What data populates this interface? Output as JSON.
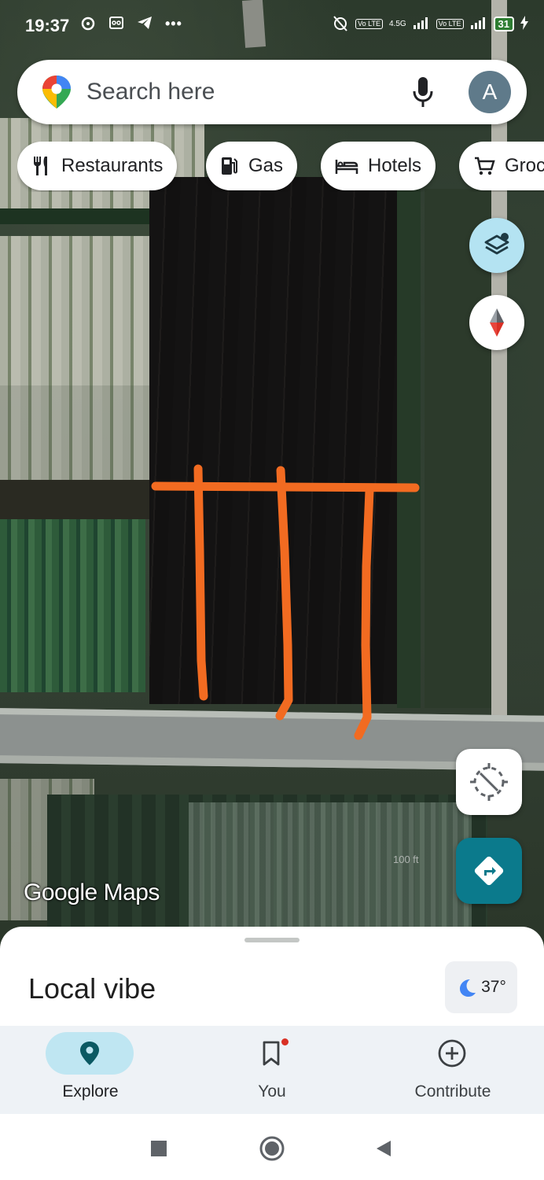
{
  "status_bar": {
    "time": "19:37",
    "battery": "31",
    "network_label": "4.5G",
    "lte_badge": "Vo LTE"
  },
  "search": {
    "placeholder": "Search here",
    "avatar_letter": "A"
  },
  "chips": [
    {
      "label": "Restaurants",
      "icon": "fork-knife-icon"
    },
    {
      "label": "Gas",
      "icon": "gas-pump-icon"
    },
    {
      "label": "Hotels",
      "icon": "bed-icon"
    },
    {
      "label": "Groceries",
      "icon": "cart-icon"
    }
  ],
  "map": {
    "watermark": "Google Maps",
    "scale_text": "100 ft"
  },
  "sheet": {
    "title": "Local vibe",
    "temperature": "37°"
  },
  "nav": [
    {
      "label": "Explore",
      "icon": "explore-pin-icon",
      "active": true
    },
    {
      "label": "You",
      "icon": "bookmark-icon",
      "active": false
    },
    {
      "label": "Contribute",
      "icon": "add-circle-icon",
      "active": false
    }
  ],
  "colors": {
    "annotation": "#f26b21",
    "directions": "#0b7a8c",
    "layers": "#b4e3f2",
    "nav_bg": "#eef2f6"
  }
}
